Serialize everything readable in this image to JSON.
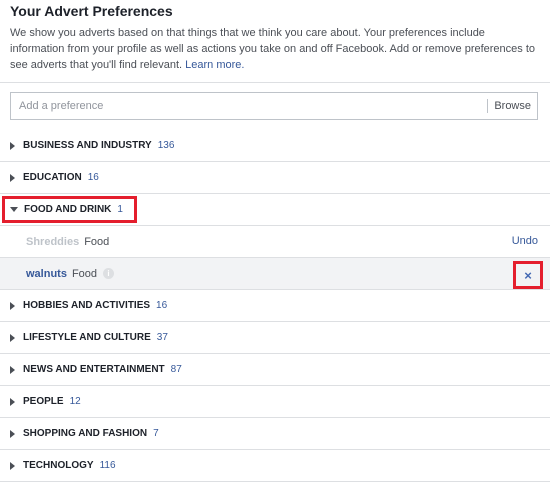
{
  "header": {
    "title": "Your Advert Preferences",
    "description": "We show you adverts based on that things that we think you care about. Your preferences include information from your profile as well as actions you take on and off Facebook. Add or remove preferences to see adverts that you'll find relevant.",
    "learn_more": "Learn more."
  },
  "search": {
    "placeholder": "Add a preference",
    "browse_label": "Browse"
  },
  "categories": [
    {
      "label": "BUSINESS AND INDUSTRY",
      "count": "136"
    },
    {
      "label": "EDUCATION",
      "count": "16"
    },
    {
      "label": "FOOD AND DRINK",
      "count": "1"
    },
    {
      "label": "HOBBIES AND ACTIVITIES",
      "count": "16"
    },
    {
      "label": "LIFESTYLE AND CULTURE",
      "count": "37"
    },
    {
      "label": "NEWS AND ENTERTAINMENT",
      "count": "87"
    },
    {
      "label": "PEOPLE",
      "count": "12"
    },
    {
      "label": "SHOPPING AND FASHION",
      "count": "7"
    },
    {
      "label": "TECHNOLOGY",
      "count": "116"
    }
  ],
  "food_items": [
    {
      "name": "Shreddies",
      "type": "Food",
      "action": "Undo"
    },
    {
      "name": "walnuts",
      "type": "Food",
      "action": "×"
    }
  ],
  "icons": {
    "collapsed": "triangle-right-icon",
    "expanded": "triangle-down-icon",
    "info": "info-icon",
    "remove": "close-icon"
  },
  "colors": {
    "link": "#365899",
    "highlight": "#e41e2d",
    "remove": "#4267b2"
  }
}
